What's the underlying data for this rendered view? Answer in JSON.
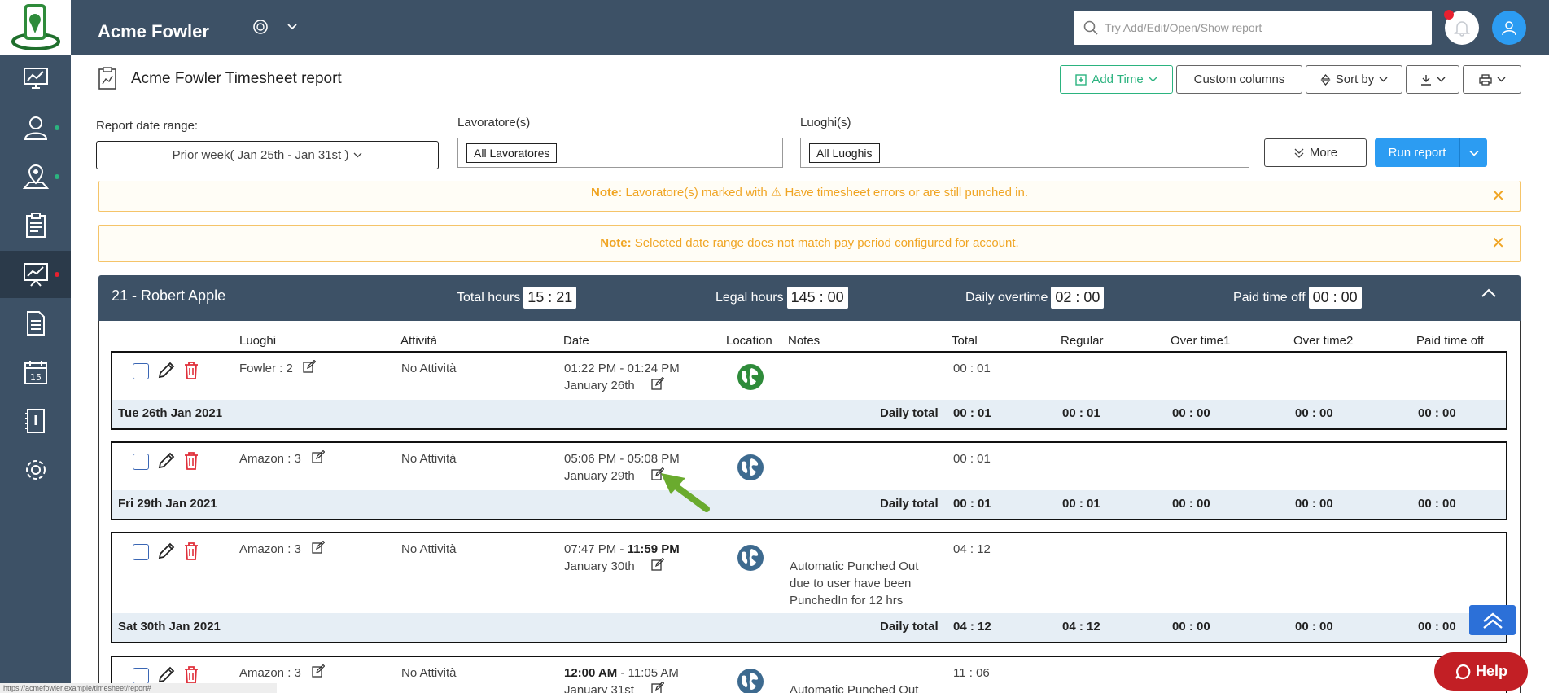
{
  "app": {
    "brand": "Acme Fowler"
  },
  "search": {
    "placeholder": "Try Add/Edit/Open/Show report"
  },
  "report": {
    "title": "Acme Fowler Timesheet report"
  },
  "toolbar": {
    "add_time": "Add Time",
    "custom_columns": "Custom columns",
    "sort_by": "Sort by"
  },
  "filters": {
    "date_label": "Report date range:",
    "date_value": "Prior week( Jan 25th - Jan 31st )",
    "workers_label": "Lavoratore(s)",
    "workers_chip": "All Lavoratores",
    "places_label": "Luoghi(s)",
    "places_chip": "All Luoghis",
    "more": "More",
    "run": "Run report"
  },
  "notes": [
    {
      "prefix": "Note:",
      "pre": "Lavoratore(s) marked with",
      "post": "Have timesheet errors or are still punched in."
    },
    {
      "prefix": "Note:",
      "text": "Selected date range does not match pay period configured for account."
    }
  ],
  "employee": {
    "name": "21 - Robert Apple",
    "total_hours_label": "Total hours",
    "total_hours": "15 : 21",
    "legal_hours_label": "Legal hours",
    "legal_hours": "145 : 00",
    "daily_ot_label": "Daily overtime",
    "daily_ot": "02 : 00",
    "pto_label": "Paid time off",
    "pto": "00 : 00"
  },
  "columns": [
    "Luoghi",
    "Attività",
    "Date",
    "Location",
    "Notes",
    "Total",
    "Regular",
    "Over time1",
    "Over time2",
    "Paid time off"
  ],
  "daily_total_label": "Daily total",
  "records": [
    {
      "place": "Fowler : 2",
      "activity": "No Attività",
      "time_start": "01:22 PM",
      "time_sep": " - ",
      "time_end": "01:24 PM",
      "date": "January 26th",
      "notes": [],
      "total": "00 : 01",
      "day": "Tue 26th Jan 2021",
      "dt_total": "00 : 01",
      "dt_regular": "00 : 01",
      "dt_ot1": "00 : 00",
      "dt_ot2": "00 : 00",
      "dt_pto": "00 : 00",
      "globe": "#2e8b3a"
    },
    {
      "place": "Amazon : 3",
      "activity": "No Attività",
      "time_start": "05:06 PM",
      "time_sep": " - ",
      "time_end": "05:08 PM",
      "date": "January 29th",
      "notes": [],
      "total": "00 : 01",
      "day": "Fri 29th Jan 2021",
      "dt_total": "00 : 01",
      "dt_regular": "00 : 01",
      "dt_ot1": "00 : 00",
      "dt_ot2": "00 : 00",
      "dt_pto": "00 : 00",
      "globe": "#3d6a8f"
    },
    {
      "place": "Amazon : 3",
      "activity": "No Attività",
      "time_start": "07:47 PM",
      "time_sep": " - ",
      "time_end": "11:59 PM",
      "date": "January 30th",
      "notes": [
        "Automatic Punched Out",
        "due to user have been",
        "PunchedIn for 12 hrs"
      ],
      "total": "04 : 12",
      "day": "Sat 30th Jan 2021",
      "dt_total": "04 : 12",
      "dt_regular": "04 : 12",
      "dt_ot1": "00 : 00",
      "dt_ot2": "00 : 00",
      "dt_pto": "00 : 00",
      "globe": "#3d6a8f"
    },
    {
      "place": "Amazon : 3",
      "activity": "No Attività",
      "time_start": "12:00 AM",
      "time_sep": " - ",
      "time_end": "11:05 AM",
      "date": "January 31st",
      "notes": [
        "Automatic Punched Out"
      ],
      "total": "11 : 06",
      "globe": "#3d6a8f"
    }
  ],
  "help": {
    "label": "Help"
  },
  "statusbar": {
    "text": "https://acmefowler.example/timesheet/report#"
  },
  "colors": {
    "sidebar": "#3d5166",
    "accent_blue": "#2c9cf2",
    "green": "#2bb37f",
    "note": "#f0a524",
    "help": "#c21f25"
  }
}
